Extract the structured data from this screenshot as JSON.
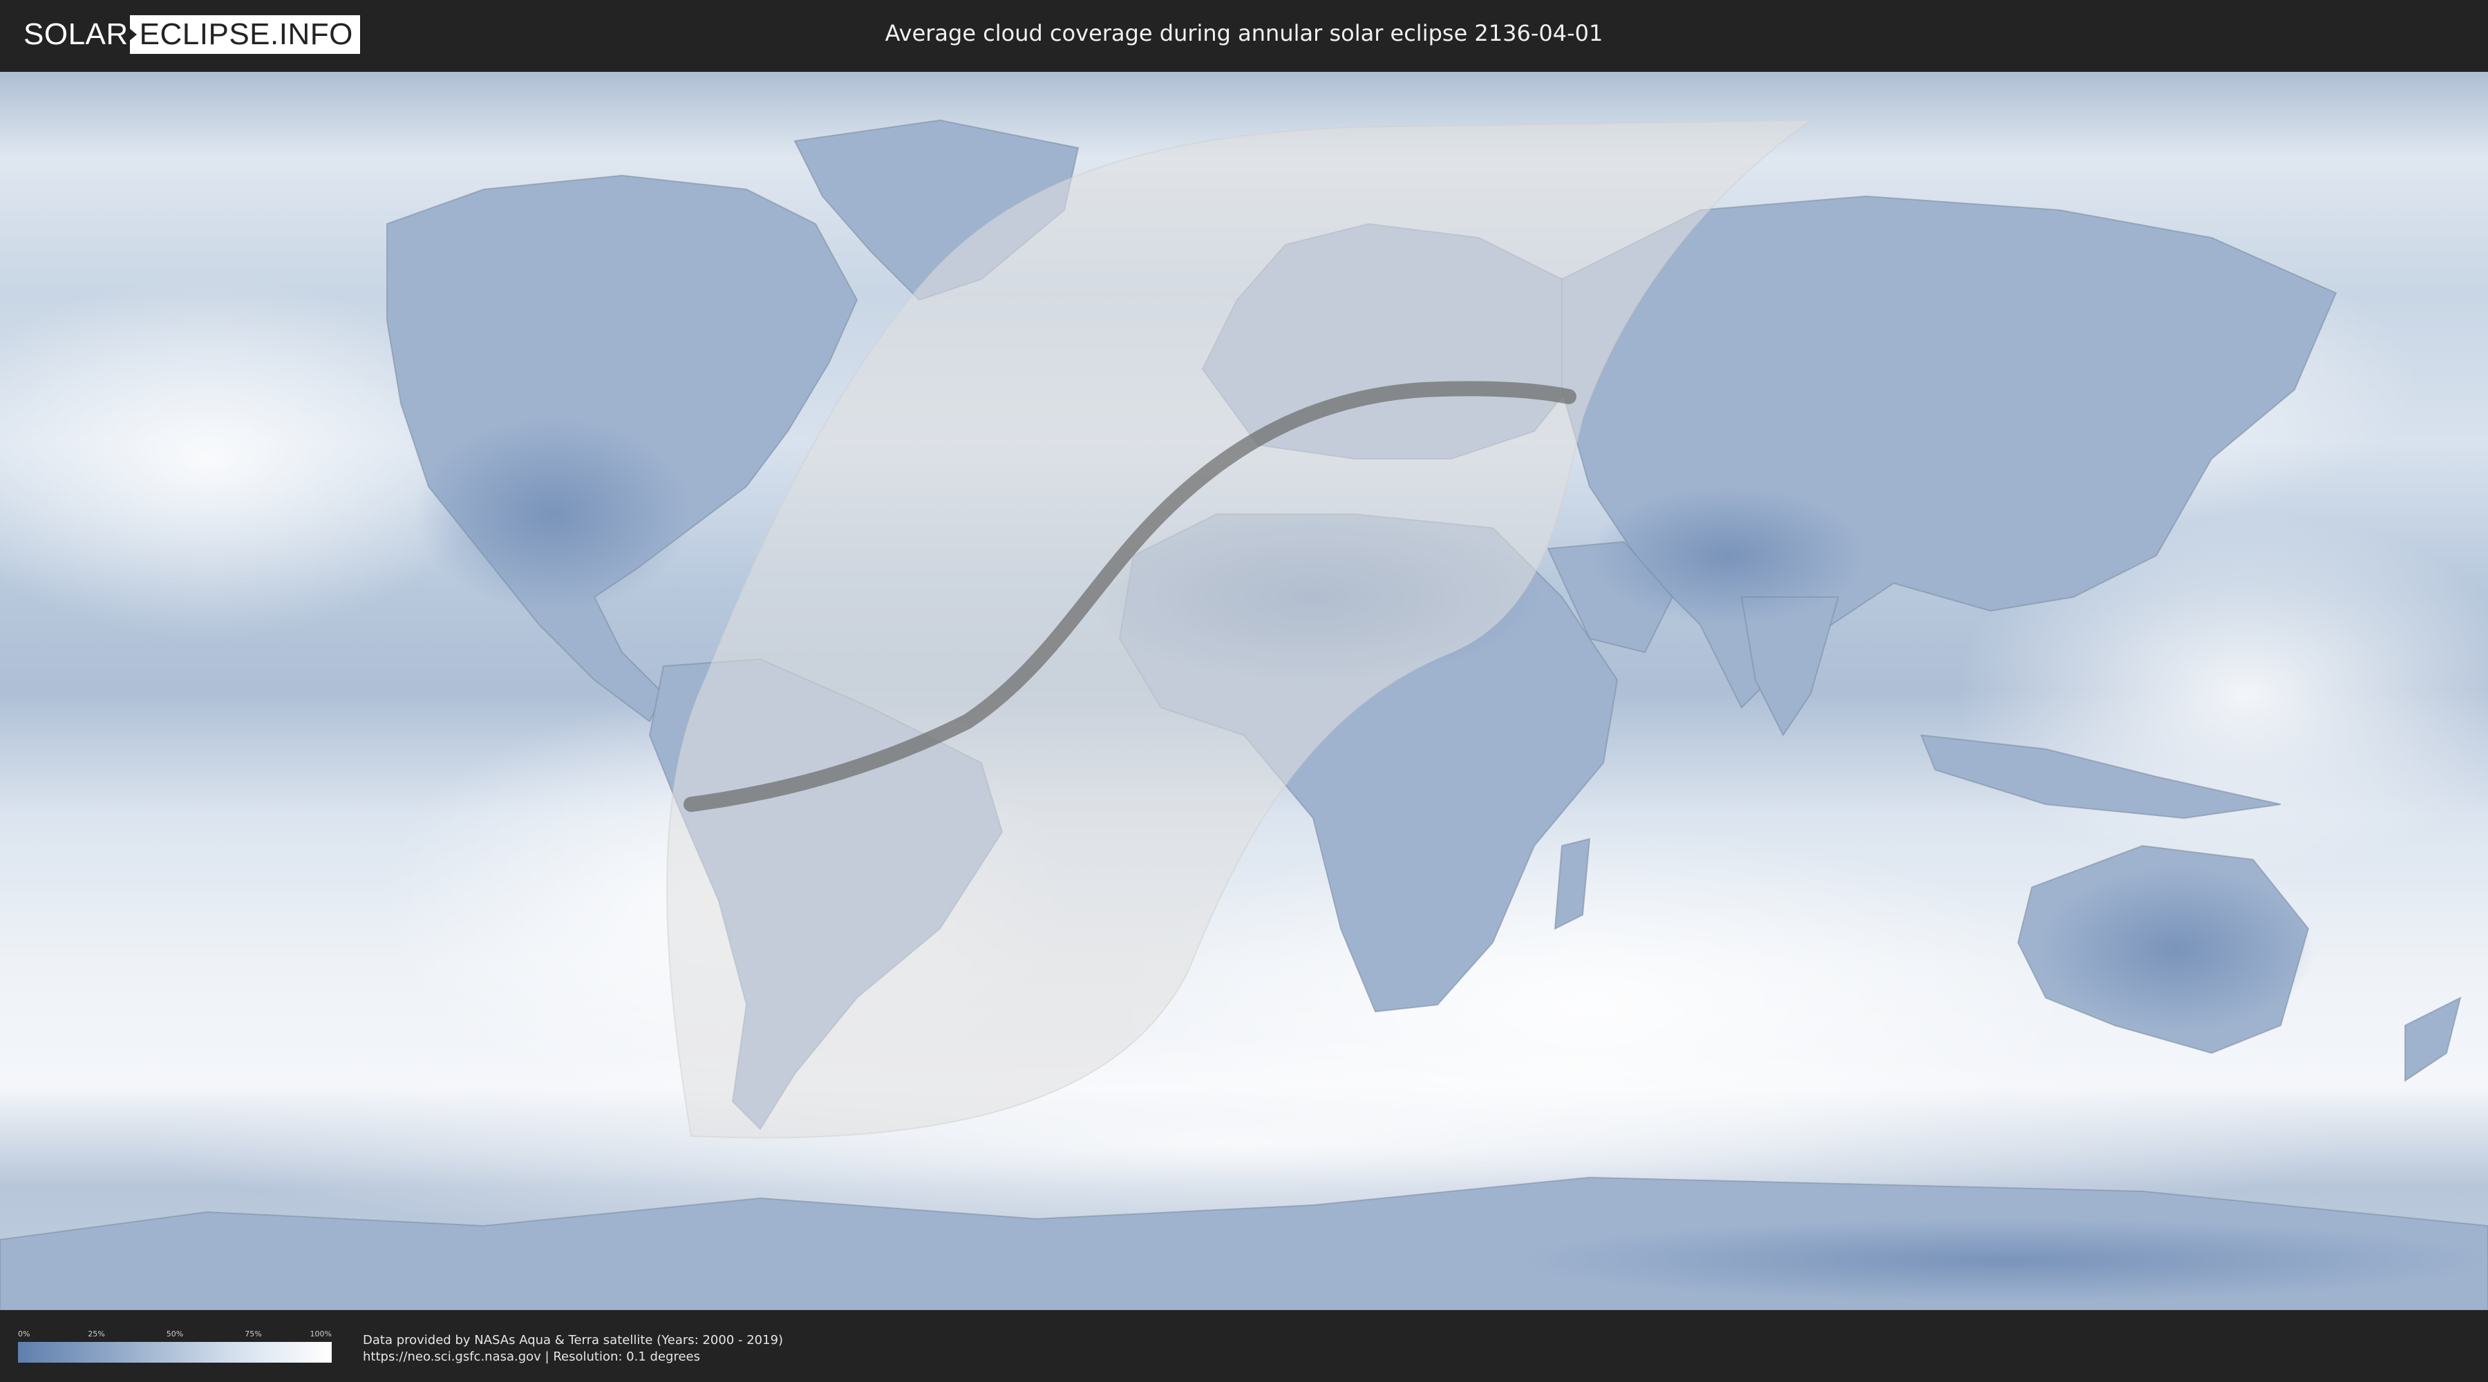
{
  "logo": {
    "part1": "SOLAR",
    "part2": "ECLIPSE.INFO"
  },
  "title": "Average cloud coverage during annular solar eclipse 2136-04-01",
  "legend": {
    "ticks": [
      "0%",
      "25%",
      "50%",
      "75%",
      "100%"
    ],
    "positions": [
      0,
      0.25,
      0.5,
      0.75,
      1.0
    ]
  },
  "credits": {
    "line1": "Data provided by NASAs Aqua & Terra satellite (Years: 2000 - 2019)",
    "line2": "https://neo.sci.gsfc.nasa.gov | Resolution: 0.1 degrees"
  },
  "colors": {
    "background": "#232323",
    "clouds": "#ffffff",
    "clear_sky": "#5f7fad",
    "eclipse_shade": "#d8d8d8",
    "central_path": "#6b6b6b"
  }
}
